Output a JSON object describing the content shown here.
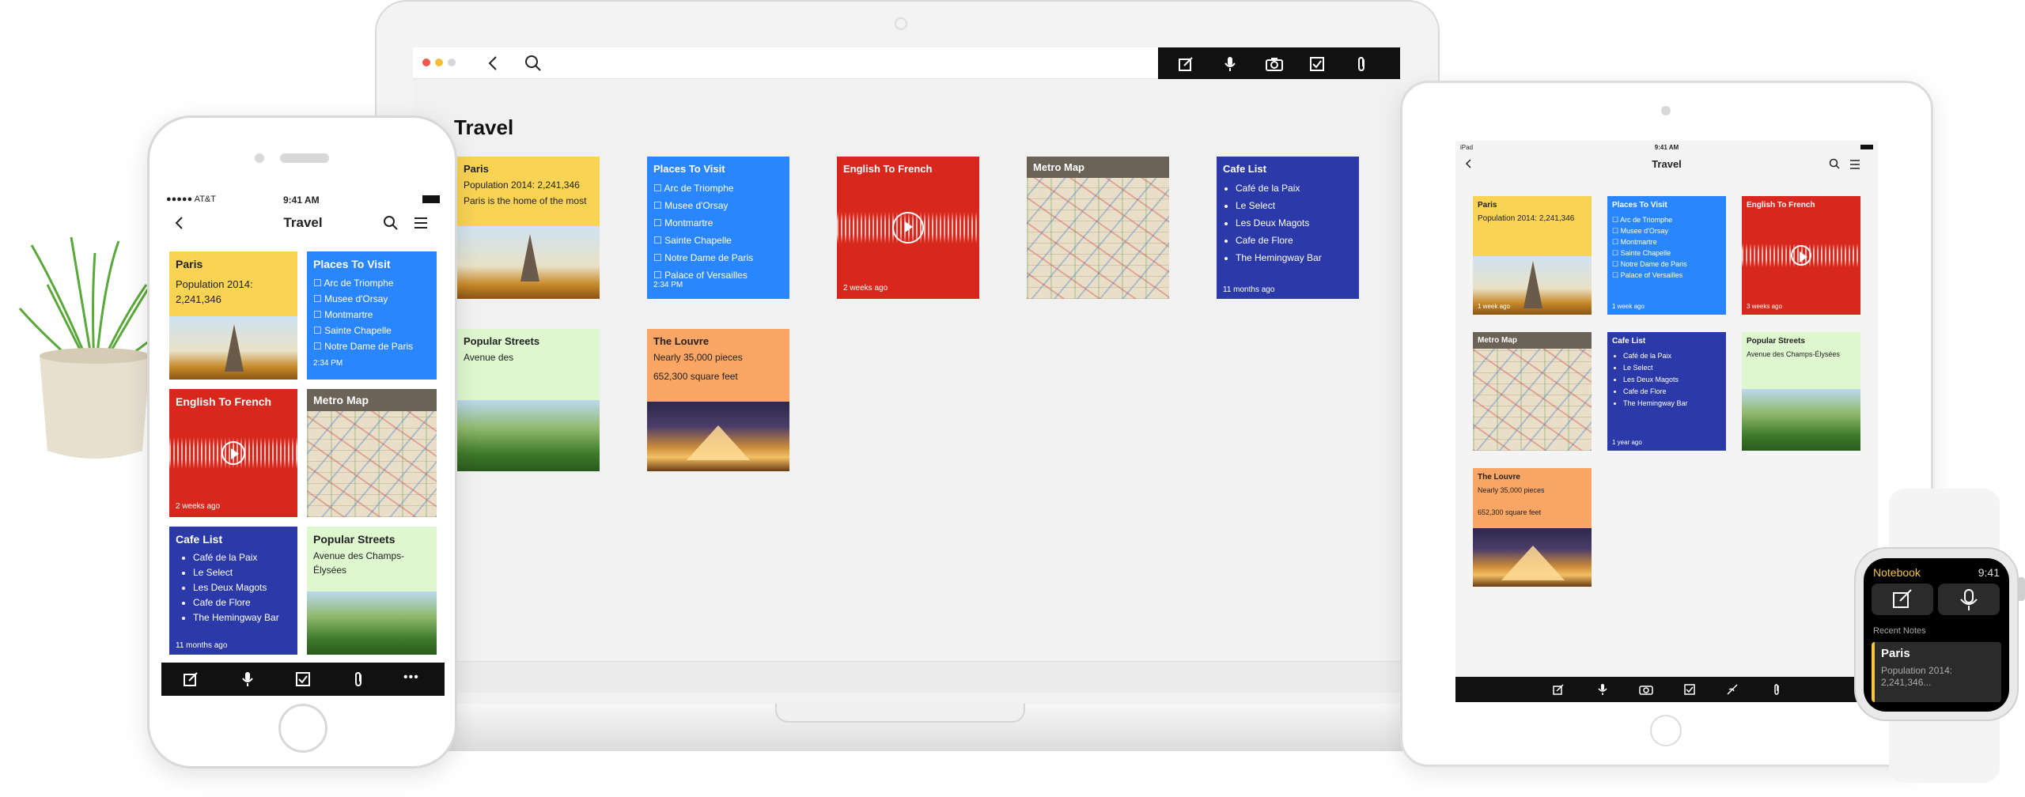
{
  "laptop": {
    "page_title": "Travel",
    "toolbar_icons": [
      "compose-icon",
      "mic-icon",
      "camera-icon",
      "checkbox-icon",
      "attach-icon"
    ],
    "notes": {
      "paris": {
        "title": "Paris",
        "line1": "Population 2014: 2,241,346",
        "line2": "Paris is the home of the most"
      },
      "places": {
        "title": "Places To Visit",
        "items": [
          "Arc de Triomphe",
          "Musee d'Orsay",
          "Montmartre",
          "Sainte Chapelle",
          "Notre Dame de Paris",
          "Palace of Versailles"
        ],
        "time": "2:34 PM"
      },
      "english": {
        "title": "English To French",
        "time": "2 weeks ago"
      },
      "metro": {
        "title": "Metro Map"
      },
      "cafe": {
        "title": "Cafe List",
        "items": [
          "Café de la Paix",
          "Le Select",
          "Les Deux Magots",
          "Cafe de Flore",
          "The Hemingway Bar"
        ],
        "time": "11 months ago"
      },
      "streets": {
        "title": "Popular Streets",
        "line1": "Avenue des"
      },
      "louvre": {
        "title": "The Louvre",
        "line1": "Nearly 35,000 pieces",
        "line2": "652,300 square feet"
      }
    }
  },
  "phone": {
    "carrier": "●●●●● AT&T",
    "time": "9:41 AM",
    "title": "Travel",
    "notes": {
      "paris": {
        "title": "Paris",
        "line1": "Population 2014: 2,241,346"
      },
      "places": {
        "title": "Places To Visit",
        "items": [
          "Arc de Triomphe",
          "Musee d'Orsay",
          "Montmartre",
          "Sainte Chapelle",
          "Notre Dame de Paris"
        ],
        "time": "2:34 PM"
      },
      "english": {
        "title": "English To French",
        "time": "2 weeks ago"
      },
      "metro": {
        "title": "Metro Map"
      },
      "cafe": {
        "title": "Cafe List",
        "items": [
          "Café de la Paix",
          "Le Select",
          "Les Deux Magots",
          "Cafe de Flore",
          "The Hemingway Bar"
        ],
        "time": "11 months ago"
      },
      "streets": {
        "title": "Popular Streets",
        "line1": "Avenue des Champs-Élysées"
      }
    },
    "more": "•••"
  },
  "tablet": {
    "carrier": "iPad",
    "time": "9:41 AM",
    "title": "Travel",
    "notes": {
      "paris": {
        "title": "Paris",
        "line1": "Population 2014: 2,241,346",
        "time": "1 week ago"
      },
      "places": {
        "title": "Places To Visit",
        "items": [
          "Arc de Triomphe",
          "Musee d'Orsay",
          "Montmartre",
          "Sainte Chapelle",
          "Notre Dame de Paris",
          "Palace of Versailles"
        ],
        "time": "1 week ago"
      },
      "english": {
        "title": "English To French",
        "time": "3 weeks ago"
      },
      "metro": {
        "title": "Metro Map"
      },
      "cafe": {
        "title": "Cafe List",
        "items": [
          "Café de la Paix",
          "Le Select",
          "Les Deux Magots",
          "Cafe de Flore",
          "The Hemingway Bar"
        ],
        "time": "1 year ago"
      },
      "streets": {
        "title": "Popular Streets",
        "line1": "Avenue des Champs-Élysées"
      },
      "louvre": {
        "title": "The Louvre",
        "line1": "Nearly 35,000 pieces",
        "line2": "652,300 square feet"
      }
    }
  },
  "watch": {
    "app": "Notebook",
    "time": "9:41",
    "section": "Recent Notes",
    "note_title": "Paris",
    "note_body": "Population 2014: 2,241,346..."
  },
  "colors": {
    "yellow": "#f9d354",
    "blue": "#2a86ff",
    "red": "#d8281d",
    "navy": "#2b3aa8",
    "green": "#dff7cf",
    "orange": "#fba664",
    "toolbar": "#111111",
    "watch_accent": "#f5c542"
  }
}
